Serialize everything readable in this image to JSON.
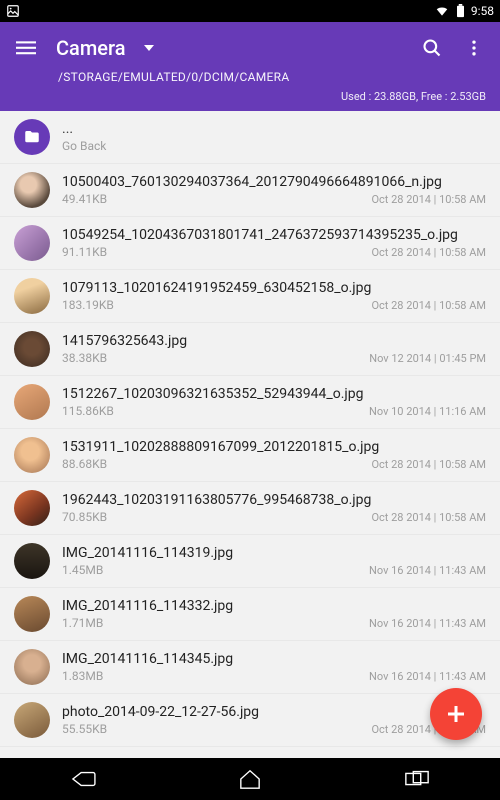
{
  "statusbar": {
    "time": "9:58"
  },
  "appbar": {
    "title": "Camera",
    "path": "/STORAGE/EMULATED/0/DCIM/CAMERA",
    "storage": "Used : 23.88GB, Free : 2.53GB"
  },
  "goback": {
    "dots": "...",
    "label": "Go Back"
  },
  "files": [
    {
      "name": "10500403_760130294037364_2012790496664891066_n.jpg",
      "size": "49.41KB",
      "date": "Oct 28 2014 | 10:58 AM",
      "thumb": "g1"
    },
    {
      "name": "10549254_10204367031801741_2476372593714395235_o.jpg",
      "size": "91.11KB",
      "date": "Oct 28 2014 | 10:58 AM",
      "thumb": "g2"
    },
    {
      "name": "1079113_10201624191952459_630452158_o.jpg",
      "size": "183.19KB",
      "date": "Oct 28 2014 | 10:58 AM",
      "thumb": "g3"
    },
    {
      "name": "1415796325643.jpg",
      "size": "38.38KB",
      "date": "Nov 12 2014 | 01:45 PM",
      "thumb": "g4"
    },
    {
      "name": "1512267_10203096321635352_52943944_o.jpg",
      "size": "115.86KB",
      "date": "Nov 10 2014 | 11:16 AM",
      "thumb": "g5"
    },
    {
      "name": "1531911_10202888809167099_2012201815_o.jpg",
      "size": "88.68KB",
      "date": "Oct 28 2014 | 10:58 AM",
      "thumb": "g6"
    },
    {
      "name": "1962443_10203191163805776_995468738_o.jpg",
      "size": "70.85KB",
      "date": "Oct 28 2014 | 10:58 AM",
      "thumb": "g7"
    },
    {
      "name": "IMG_20141116_114319.jpg",
      "size": "1.45MB",
      "date": "Nov 16 2014 | 11:43 AM",
      "thumb": "g8"
    },
    {
      "name": "IMG_20141116_114332.jpg",
      "size": "1.71MB",
      "date": "Nov 16 2014 | 11:43 AM",
      "thumb": "g9"
    },
    {
      "name": "IMG_20141116_114345.jpg",
      "size": "1.83MB",
      "date": "Nov 16 2014 | 11:43 AM",
      "thumb": "g10"
    },
    {
      "name": "photo_2014-09-22_12-27-56.jpg",
      "size": "55.55KB",
      "date": "Oct 28 2014 | 10:58 AM",
      "thumb": "g11"
    }
  ]
}
